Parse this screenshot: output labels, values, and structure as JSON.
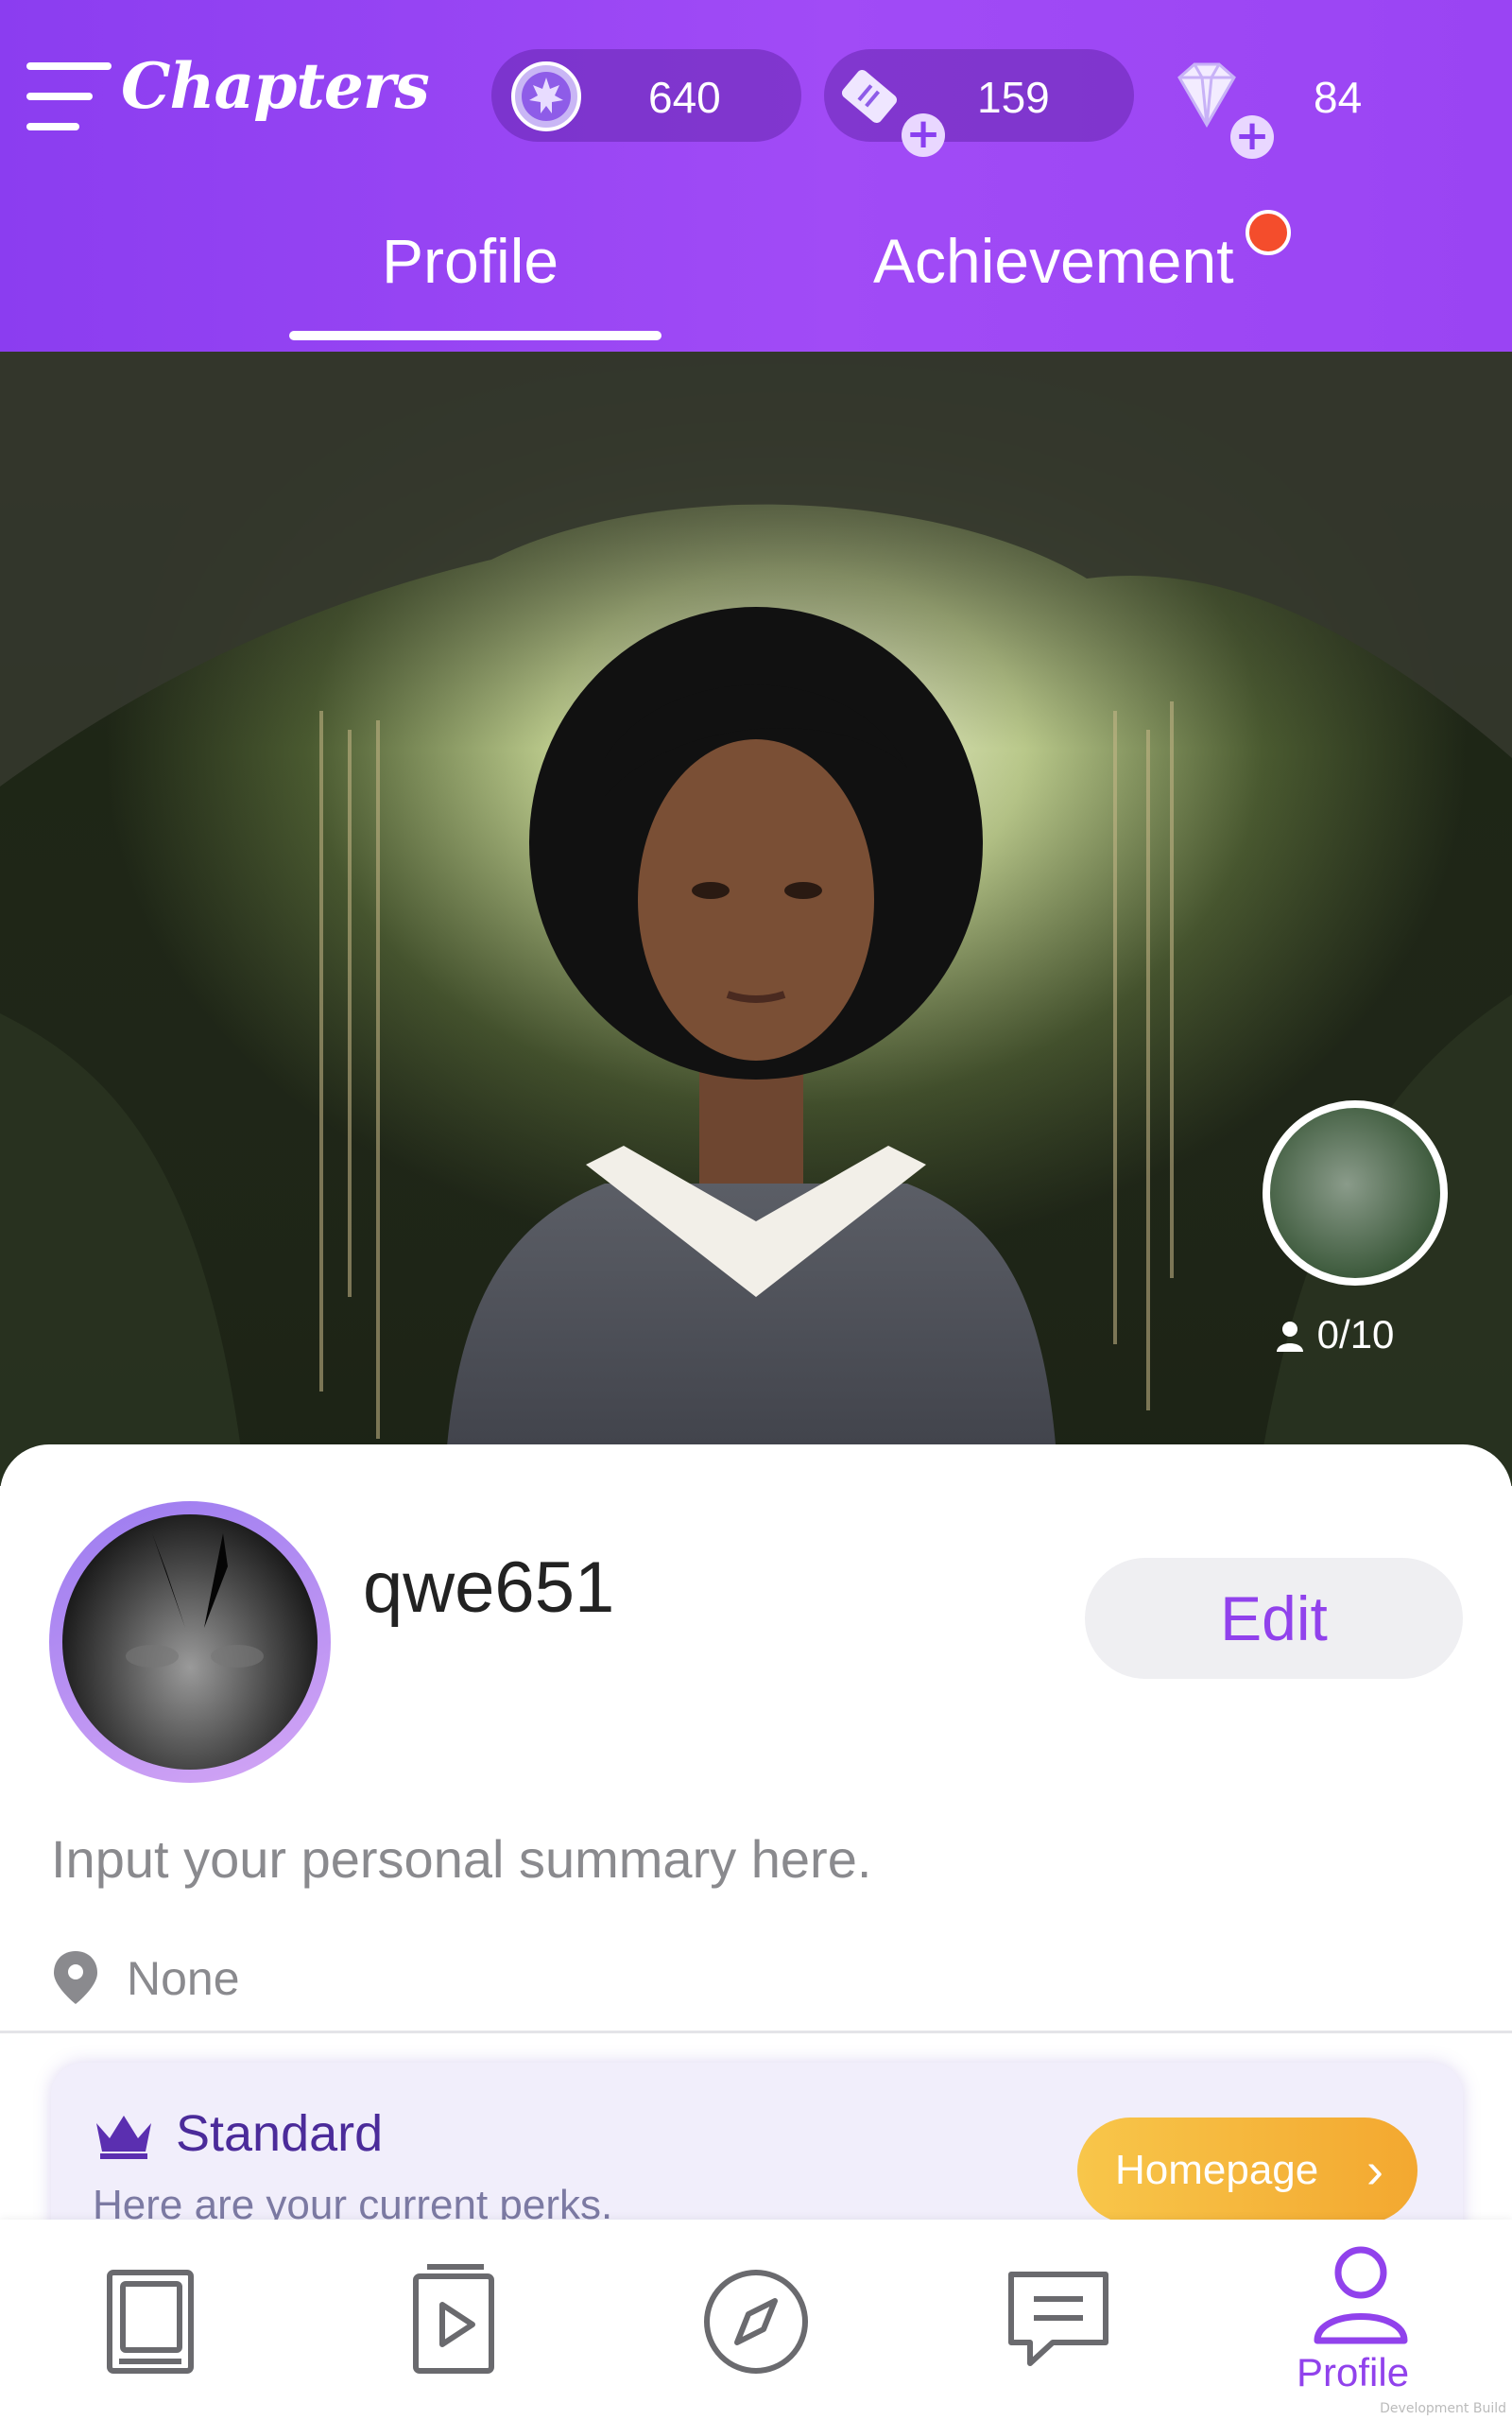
{
  "header": {
    "logo": "Chapters",
    "currencies": [
      {
        "name": "leaf-coin-icon",
        "value": "640"
      },
      {
        "name": "ticket-icon",
        "value": "159"
      },
      {
        "name": "diamond-icon",
        "value": "84"
      }
    ],
    "tabs": [
      {
        "label": "Profile",
        "active": true
      },
      {
        "label": "Achievement",
        "active": false,
        "notification": true
      }
    ]
  },
  "hero": {
    "friends_count": "0/10"
  },
  "profile": {
    "username": "qwe651",
    "edit_label": "Edit",
    "summary_placeholder": "Input your personal summary here.",
    "location": "None"
  },
  "perks": {
    "tier": "Standard",
    "subtitle": "Here are your current perks.",
    "button_label": "Homepage"
  },
  "bottom_nav": {
    "items": [
      {
        "icon": "library-icon",
        "label": ""
      },
      {
        "icon": "video-icon",
        "label": ""
      },
      {
        "icon": "compass-icon",
        "label": ""
      },
      {
        "icon": "chat-icon",
        "label": ""
      },
      {
        "icon": "profile-icon",
        "label": "Profile",
        "active": true
      }
    ]
  },
  "watermark": "Development Build",
  "colors": {
    "header_purple": "#9a44f3",
    "accent_purple": "#9142ec",
    "notification_red": "#f44d2c",
    "homepage_gold": "#f3a830"
  }
}
